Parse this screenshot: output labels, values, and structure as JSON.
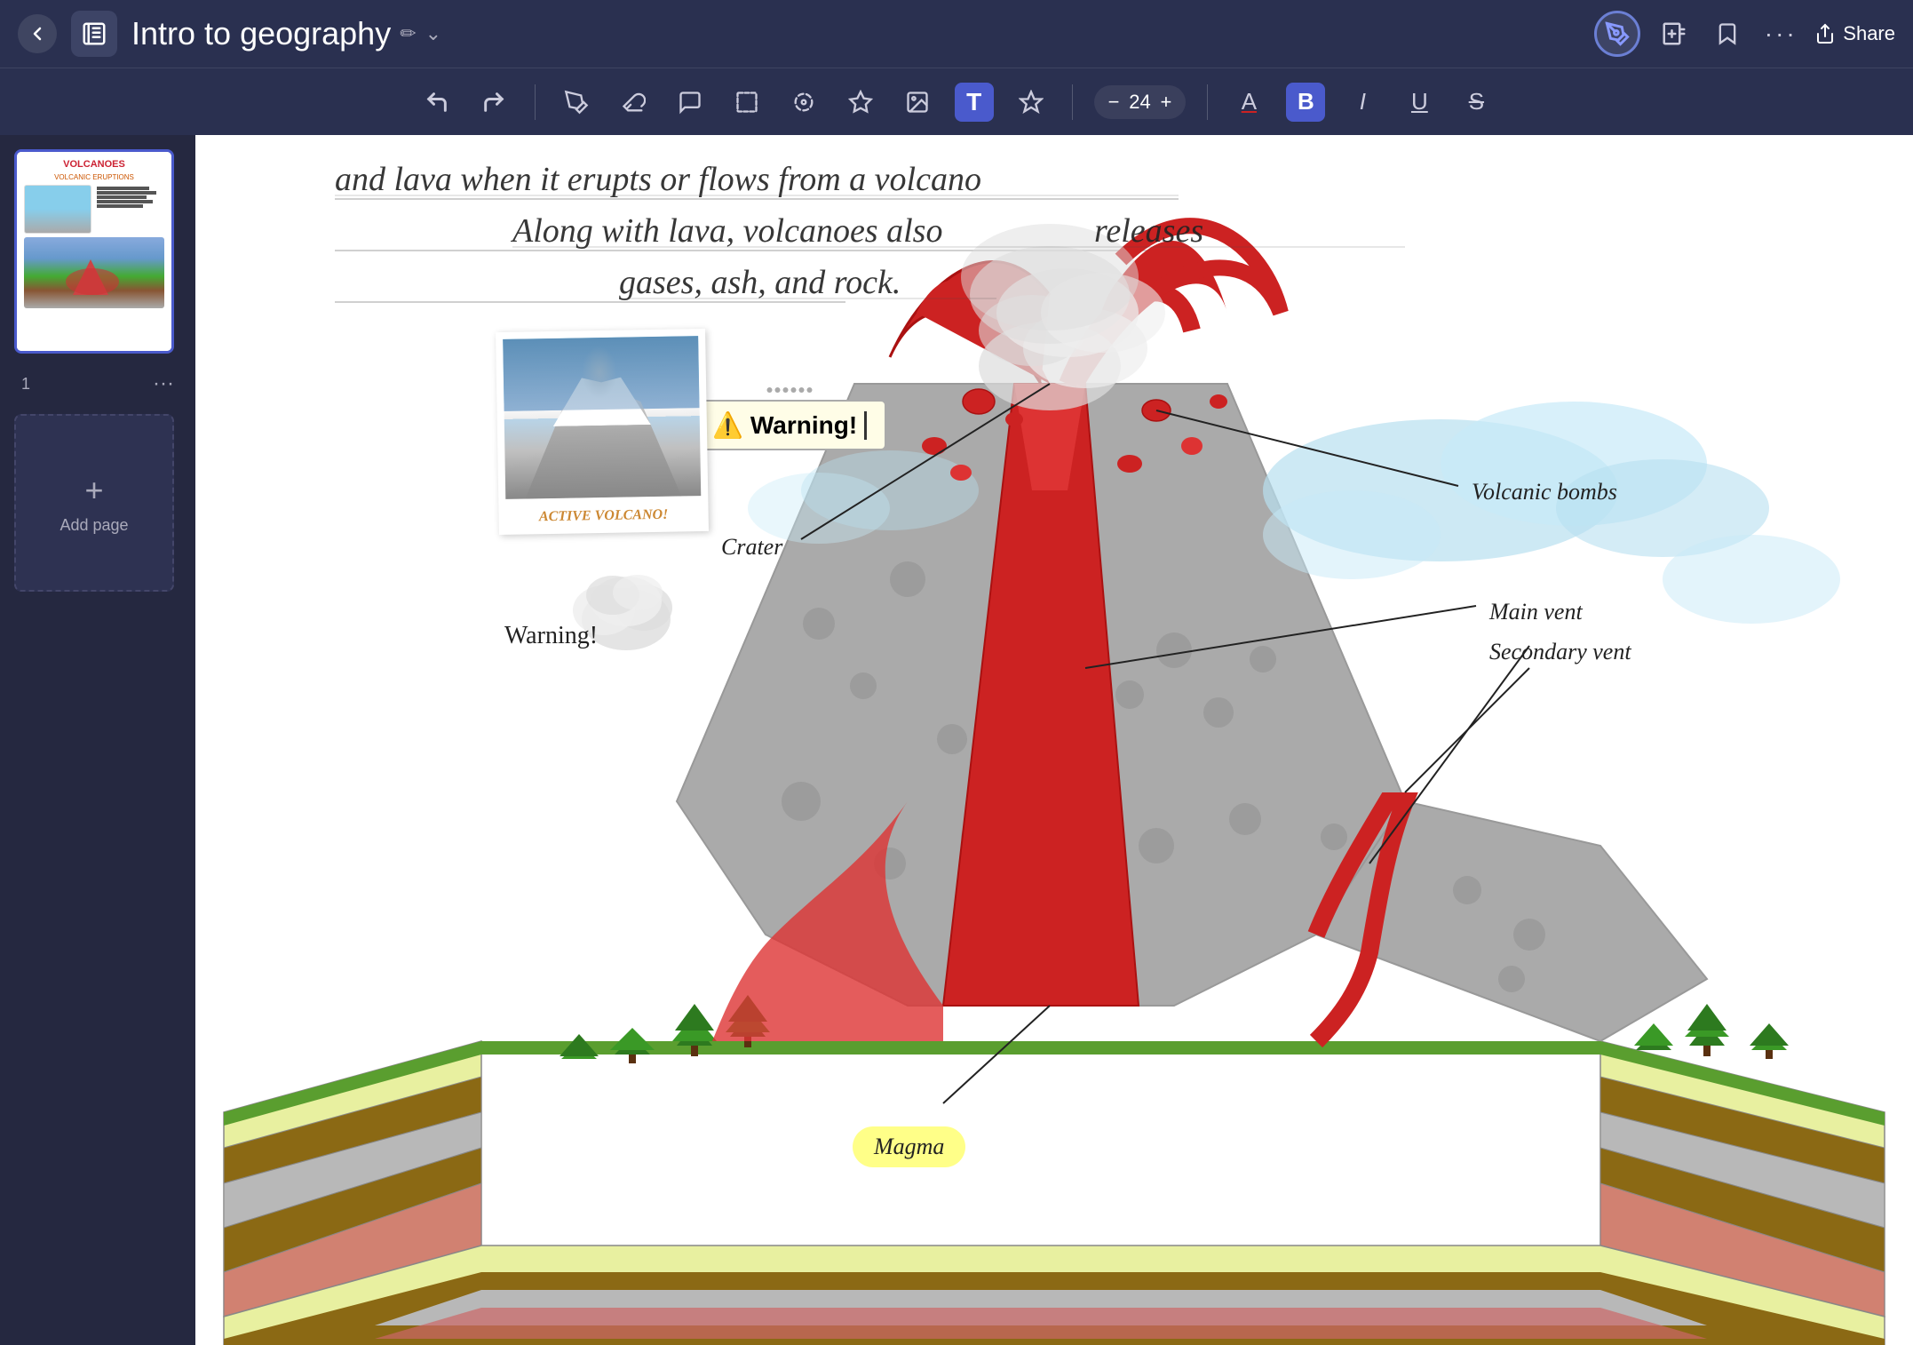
{
  "header": {
    "back_label": "←",
    "notebook_icon": "📋",
    "title": "Intro to geography",
    "pencil_icon": "✏",
    "chevron_icon": "⌄",
    "share_label": "Share",
    "avatar_label": "pen"
  },
  "toolbar": {
    "undo_label": "↩",
    "redo_label": "↪",
    "pen_label": "✏",
    "eraser_label": "◻",
    "marker_label": "✒",
    "select_rect_label": "⊡",
    "lasso_label": "⊙",
    "star_label": "★",
    "image_label": "🖼",
    "text_label": "T",
    "magic_label": "✦",
    "font_size_minus": "−",
    "font_size_value": "24",
    "font_size_plus": "+",
    "text_a_label": "A",
    "bold_label": "B",
    "italic_label": "I",
    "underline_label": "U",
    "strikethrough_label": "S"
  },
  "sidebar": {
    "page_number": "1",
    "more_icon": "···",
    "add_page_plus": "+",
    "add_page_label": "Add page",
    "thumb_title": "VOLCANOES",
    "thumb_subtitle": "VOLCANIC ERUPTIONS"
  },
  "canvas": {
    "text_line1": "and lava when it erupts or flows from a volcano",
    "text_line2": "Along with lava, volcanoes also releases",
    "text_line3": "gases, ash, and rock.",
    "warning_emoji": "⚠️",
    "warning_text": "Warning!",
    "polaroid_caption": "ACTIVE VOLCANO!",
    "warning_bottom": "Warning!",
    "label_volcanic_bombs": "Volcanic bombs",
    "label_crater": "Crater",
    "label_main_vent": "Main vent",
    "label_secondary_vent": "Secondary vent",
    "label_magma": "Magma",
    "releases_highlight": "releases"
  },
  "colors": {
    "header_bg": "#2a3050",
    "sidebar_bg": "#252840",
    "accent": "#4a5acc",
    "canvas_bg": "#ffffff",
    "warning_bg": "#fffde7",
    "magma_label_bg": "#ffff88",
    "text_color": "#222222"
  }
}
